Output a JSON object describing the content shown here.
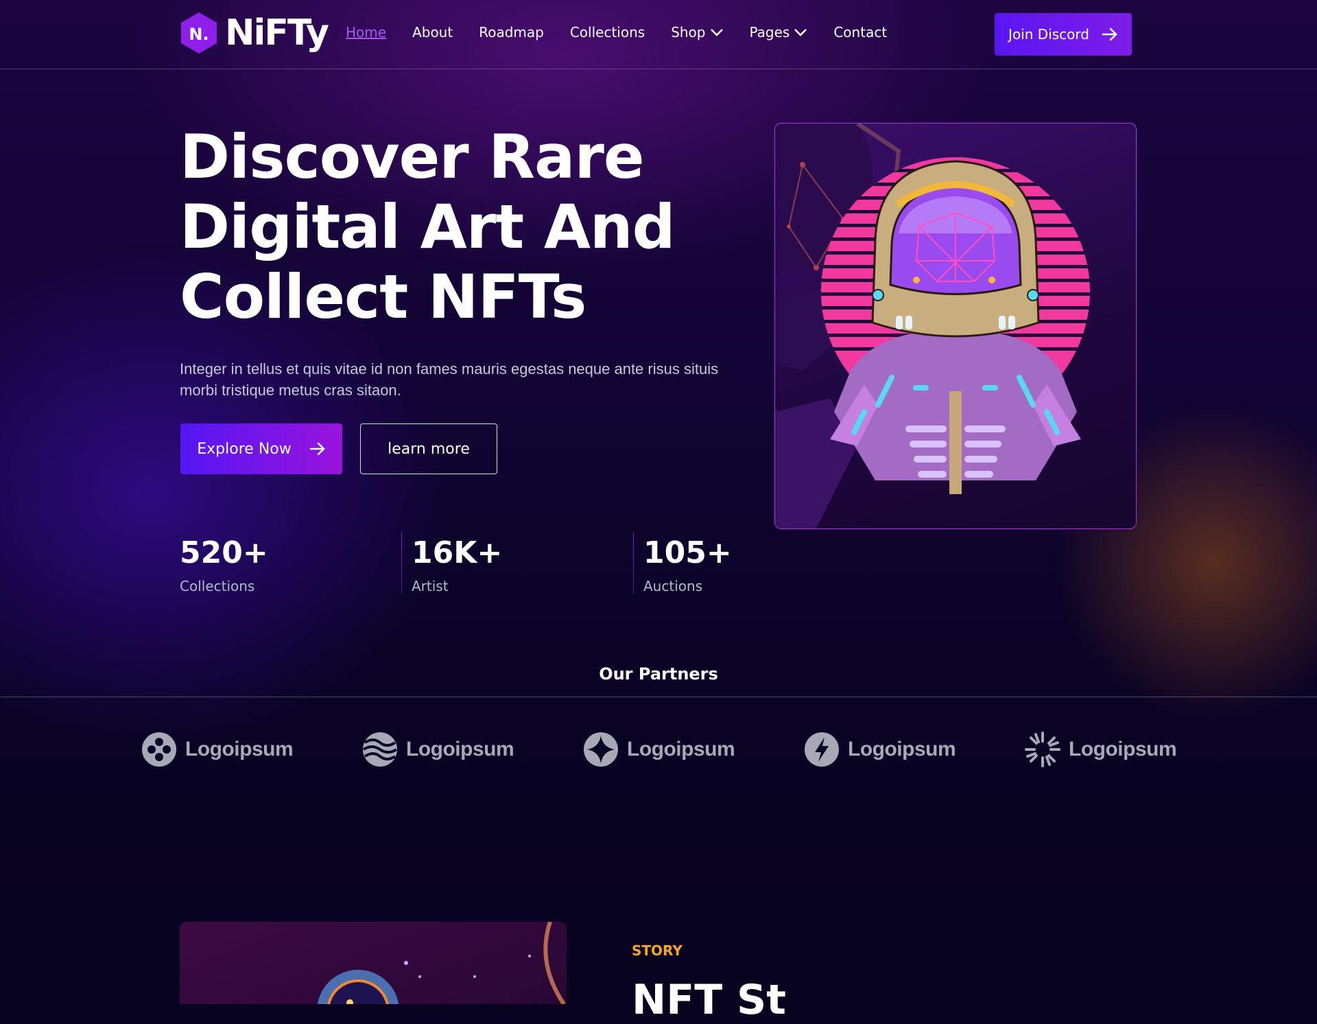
{
  "brand": {
    "logo_mark": "N.",
    "logo_text": "NiFTy"
  },
  "nav": {
    "items": [
      {
        "label": "Home",
        "active": true
      },
      {
        "label": "About"
      },
      {
        "label": "Roadmap"
      },
      {
        "label": "Collections"
      },
      {
        "label": "Shop",
        "dropdown": true
      },
      {
        "label": "Pages",
        "dropdown": true
      },
      {
        "label": "Contact"
      }
    ],
    "cta": "Join Discord"
  },
  "hero": {
    "title_lines": [
      "Discover Rare",
      "Digital Art And",
      "Collect NFTs"
    ],
    "description": "Integer in tellus et quis vitae id non fames mauris egestas neque ante risus situis morbi tristique metus cras sitaon.",
    "primary_button": "Explore Now",
    "secondary_button": "learn more",
    "image_icon": "astronaut-illustration"
  },
  "stats": [
    {
      "value": "520+",
      "label": "Collections"
    },
    {
      "value": "16K+",
      "label": "Artist"
    },
    {
      "value": "105+",
      "label": "Auctions"
    }
  ],
  "partners": {
    "title": "Our Partners",
    "logos": [
      {
        "name": "Logoipsum",
        "icon": "logo-circle-dots-icon"
      },
      {
        "name": "Logoipsum",
        "icon": "logo-waves-icon"
      },
      {
        "name": "Logoipsum",
        "icon": "logo-star-icon"
      },
      {
        "name": "Logoipsum",
        "icon": "logo-bolt-icon"
      },
      {
        "name": "Logoipsum",
        "icon": "logo-sunburst-icon"
      }
    ]
  },
  "story": {
    "label": "STORY",
    "title": "NFT St"
  },
  "colors": {
    "accent": "#5a16f0",
    "accent2": "#a855f7",
    "story": "#f5a524",
    "background": "#08031e"
  }
}
